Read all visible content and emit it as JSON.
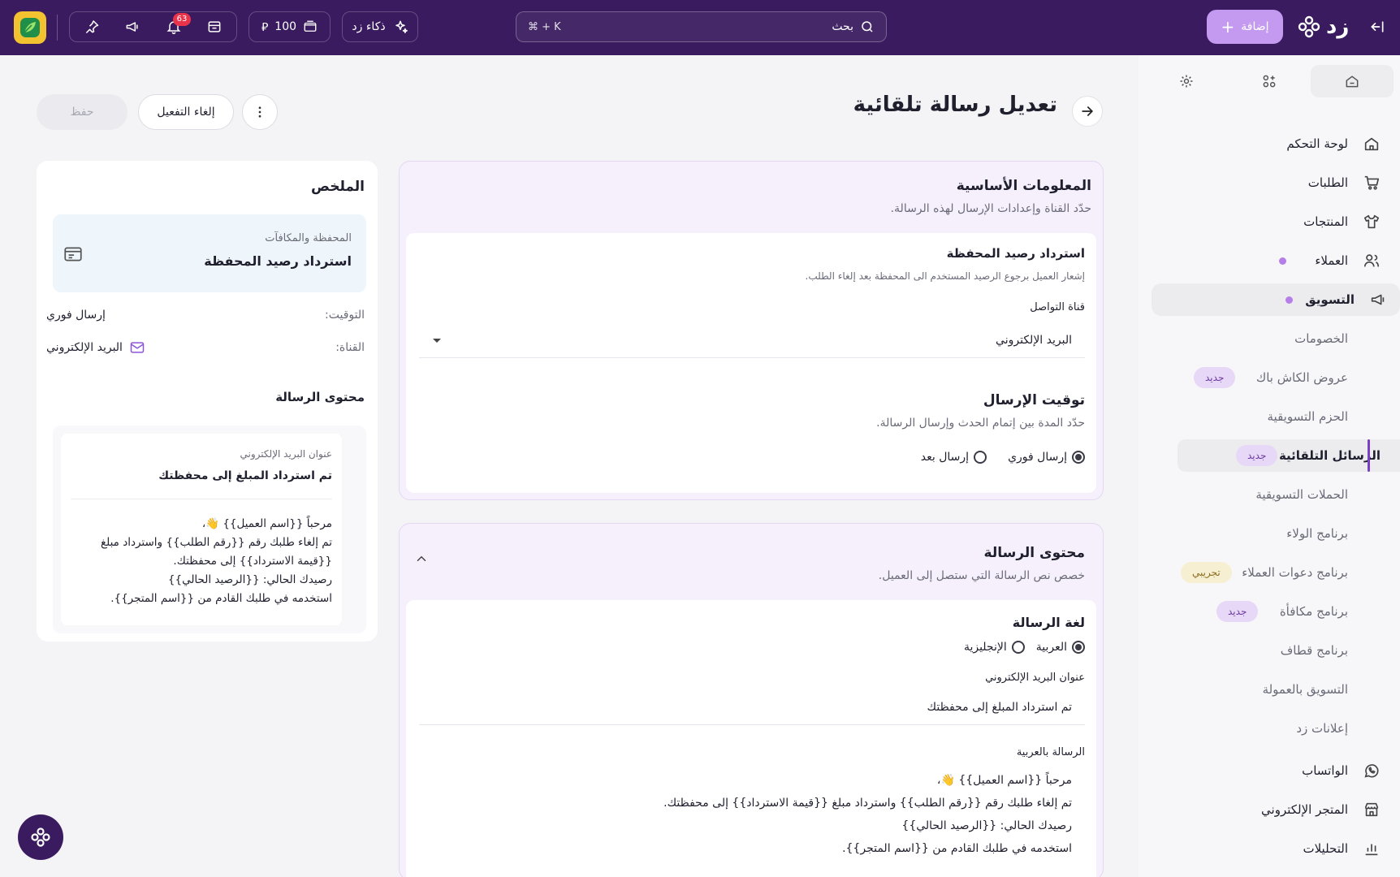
{
  "topbar": {
    "brand": "زد",
    "add_button": "إضافة",
    "search_placeholder": "بحث",
    "search_shortcut": "⌘ + K",
    "ai_label": "ذكاء زد",
    "balance": "100",
    "notifications_count": "63"
  },
  "sidebar": {
    "items": [
      {
        "label": "لوحة التحكم"
      },
      {
        "label": "الطلبات"
      },
      {
        "label": "المنتجات"
      },
      {
        "label": "العملاء"
      },
      {
        "label": "التسويق"
      },
      {
        "label": "الخصومات"
      },
      {
        "label": "عروض الكاش باك",
        "tag": "جديد"
      },
      {
        "label": "الحزم التسويقية"
      },
      {
        "label": "الرسائل التلقائية",
        "tag": "جديد"
      },
      {
        "label": "الحملات التسويقية"
      },
      {
        "label": "برنامج الولاء"
      },
      {
        "label": "برنامج دعوات العملاء",
        "tag": "تجريبي"
      },
      {
        "label": "برنامج مكافأة",
        "tag": "جديد"
      },
      {
        "label": "برنامج قطاف"
      },
      {
        "label": "التسويق بالعمولة"
      },
      {
        "label": "إعلانات زد"
      },
      {
        "label": "الواتساب"
      },
      {
        "label": "المتجر الإلكتروني"
      },
      {
        "label": "التحليلات"
      }
    ]
  },
  "header": {
    "title": "تعديل رسالة تلقائية",
    "deactivate": "إلغاء التفعيل",
    "save": "حفظ"
  },
  "basic_info": {
    "title": "المعلومات الأساسية",
    "subtitle": "حدّد القناة وإعدادات الإرسال لهذه الرسالة.",
    "event_title": "استرداد رصيد المحفظة",
    "event_desc": "إشعار العميل برجوع الرصيد المستخدم الى المحفظة بعد إلغاء الطلب.",
    "channel_label": "قناة التواصل",
    "channel_value": "البريد الإلكتروني",
    "timing_title": "توقيت الإرسال",
    "timing_subtitle": "حدّد المدة بين إتمام الحدث وإرسال الرسالة.",
    "timing_instant": "إرسال فوري",
    "timing_later": "إرسال بعد"
  },
  "content": {
    "title": "محتوى الرسالة",
    "subtitle": "خصص نص الرسالة التي ستصل إلى العميل.",
    "lang_title": "لغة الرسالة",
    "lang_ar": "العربية",
    "lang_en": "الإنجليزية",
    "subject_label": "عنوان البريد الإلكتروني",
    "subject_value": "تم استرداد المبلغ إلى محفظتك",
    "body_label": "الرسالة بالعربية",
    "body_lines": [
      "مرحباً {{اسم العميل}} 👋،",
      "تم إلغاء طلبك رقم {{رقم الطلب}} واسترداد مبلغ {{قيمة الاسترداد}} إلى محفظتك.",
      "رصيدك الحالي: {{الرصيد الحالي}}",
      "استخدمه في طلبك القادم من {{اسم المتجر}}."
    ]
  },
  "summary": {
    "title": "الملخص",
    "category": "المحفظة والمكافآت",
    "event": "استرداد رصيد المحفظة",
    "timing_label": "التوقيت:",
    "timing_value": "إرسال فوري",
    "channel_label": "القناة:",
    "channel_value": "البريد الإلكتروني",
    "content_title": "محتوى الرسالة",
    "subject_label": "عنوان البريد الإلكتروني",
    "subject_value": "تم استرداد المبلغ إلى محفظتك",
    "body_lines": [
      "مرحباً {{اسم العميل}} 👋،",
      "تم إلغاء طلبك رقم {{رقم الطلب}} واسترداد مبلغ",
      "{{قيمة الاسترداد}} إلى محفظتك.",
      "رصيدك الحالي: {{الرصيد الحالي}}",
      "استخدمه في طلبك القادم من {{اسم المتجر}}."
    ]
  }
}
